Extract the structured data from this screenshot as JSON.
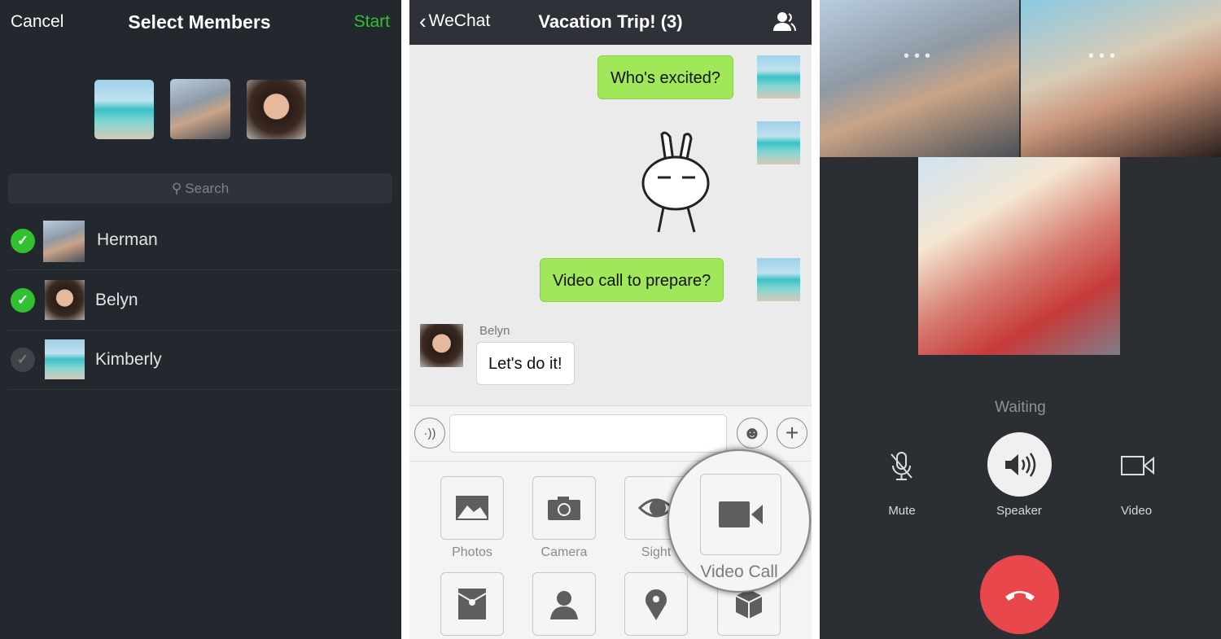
{
  "select_members": {
    "cancel_label": "Cancel",
    "title": "Select Members",
    "start_label": "Start",
    "search_placeholder": "Search",
    "members": [
      {
        "name": "Herman",
        "selected": true
      },
      {
        "name": "Belyn",
        "selected": true
      },
      {
        "name": "Kimberly",
        "selected": false
      }
    ]
  },
  "chat": {
    "back_label": "WeChat",
    "title": "Vacation Trip! (3)",
    "messages": [
      {
        "text": "Who's excited?",
        "sender": "me"
      },
      {
        "text": "",
        "sender": "me",
        "type": "sticker"
      },
      {
        "text": "Video call to prepare?",
        "sender": "me"
      },
      {
        "sender_name": "Belyn",
        "text": "Let's do it!",
        "sender": "other"
      }
    ],
    "input_value": "",
    "actions": [
      "Photos",
      "Camera",
      "Sight",
      "Video Call"
    ],
    "action_icons": [
      "image-icon",
      "camera-icon",
      "eye-icon",
      "video-camera-icon",
      "red-packet-icon",
      "contact-card-icon",
      "location-pin-icon",
      "box-icon"
    ],
    "accent": "#a0e75a"
  },
  "call": {
    "status": "Waiting",
    "controls": {
      "mute": "Mute",
      "speaker": "Speaker",
      "video": "Video"
    },
    "hangup_color": "#e8474c"
  }
}
